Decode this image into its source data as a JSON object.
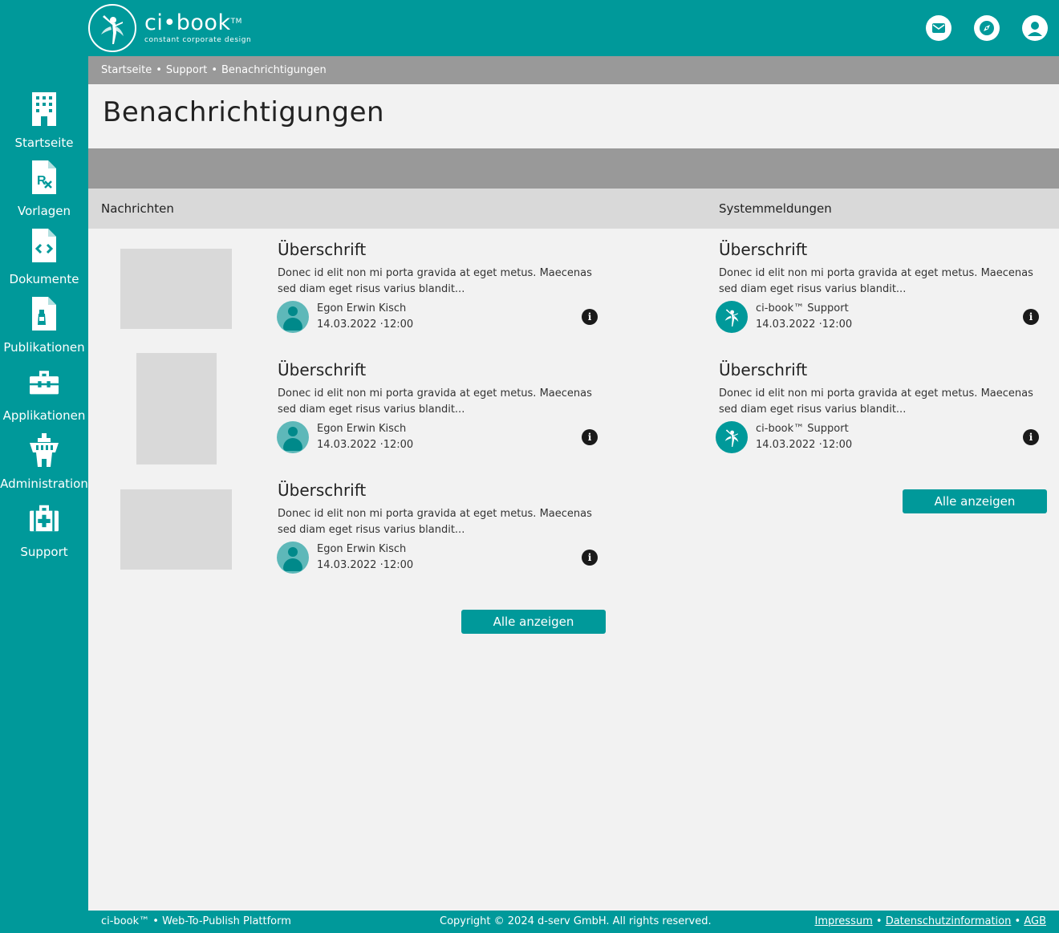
{
  "header": {
    "logo_title": "ci•book",
    "logo_tm": "TM",
    "logo_sub": "constant corporate design",
    "icons": [
      "mail-icon",
      "compass-icon",
      "user-icon"
    ]
  },
  "sidebar": {
    "items": [
      {
        "label": "Startseite",
        "icon": "building-icon"
      },
      {
        "label": "Vorlagen",
        "icon": "prescription-document-icon"
      },
      {
        "label": "Dokumente",
        "icon": "code-document-icon"
      },
      {
        "label": "Publikationen",
        "icon": "bottle-document-icon"
      },
      {
        "label": "Applikationen",
        "icon": "toolbox-icon"
      },
      {
        "label": "Administration",
        "icon": "tower-icon"
      },
      {
        "label": "Support",
        "icon": "first-aid-kit-icon"
      }
    ]
  },
  "breadcrumb": {
    "items": [
      "Startseite",
      "Support",
      "Benachrichtigungen"
    ],
    "separator": "•"
  },
  "page": {
    "title": "Benachrichtigungen"
  },
  "nachrichten": {
    "title": "Nachrichten",
    "items": [
      {
        "title": "Überschrift",
        "text": "Donec id elit non mi porta gravida at eget metus. Maecenas sed diam eget risus varius blandit...",
        "author": "Egon Erwin Kisch",
        "date": "14.03.2022 ·12:00"
      },
      {
        "title": "Überschrift",
        "text": "Donec id elit non mi porta gravida at eget metus. Maecenas sed diam eget risus varius blandit...",
        "author": "Egon Erwin Kisch",
        "date": "14.03.2022 ·12:00"
      },
      {
        "title": "Überschrift",
        "text": "Donec id elit non mi porta gravida at eget metus. Maecenas sed diam eget risus varius blandit...",
        "author": "Egon Erwin Kisch",
        "date": "14.03.2022 ·12:00"
      }
    ],
    "button_label": "Alle anzeigen"
  },
  "systemmeldungen": {
    "title": "Systemmeldungen",
    "items": [
      {
        "title": "Überschrift",
        "text": "Donec id elit non mi porta gravida at eget metus. Maecenas sed diam eget risus varius blandit...",
        "author": "ci-book™ Support",
        "date": "14.03.2022 ·12:00"
      },
      {
        "title": "Überschrift",
        "text": "Donec id elit non mi porta gravida at eget metus. Maecenas sed diam eget risus varius blandit...",
        "author": "ci-book™ Support",
        "date": "14.03.2022 ·12:00"
      }
    ],
    "button_label": "Alle anzeigen"
  },
  "info_glyph": "i",
  "footer": {
    "left": "ci-book™ • Web-To-Publish Plattform",
    "copyright": "Copyright © 2024 d-serv GmbH. All rights reserved.",
    "links": [
      "Impressum",
      "Datenschutzinformation",
      "AGB"
    ],
    "separator": "•"
  },
  "colors": {
    "brand": "#00999a",
    "breadcrumb_bg": "#999999",
    "section_bg": "#d9d9d9",
    "page_bg": "#f2f2f2"
  }
}
